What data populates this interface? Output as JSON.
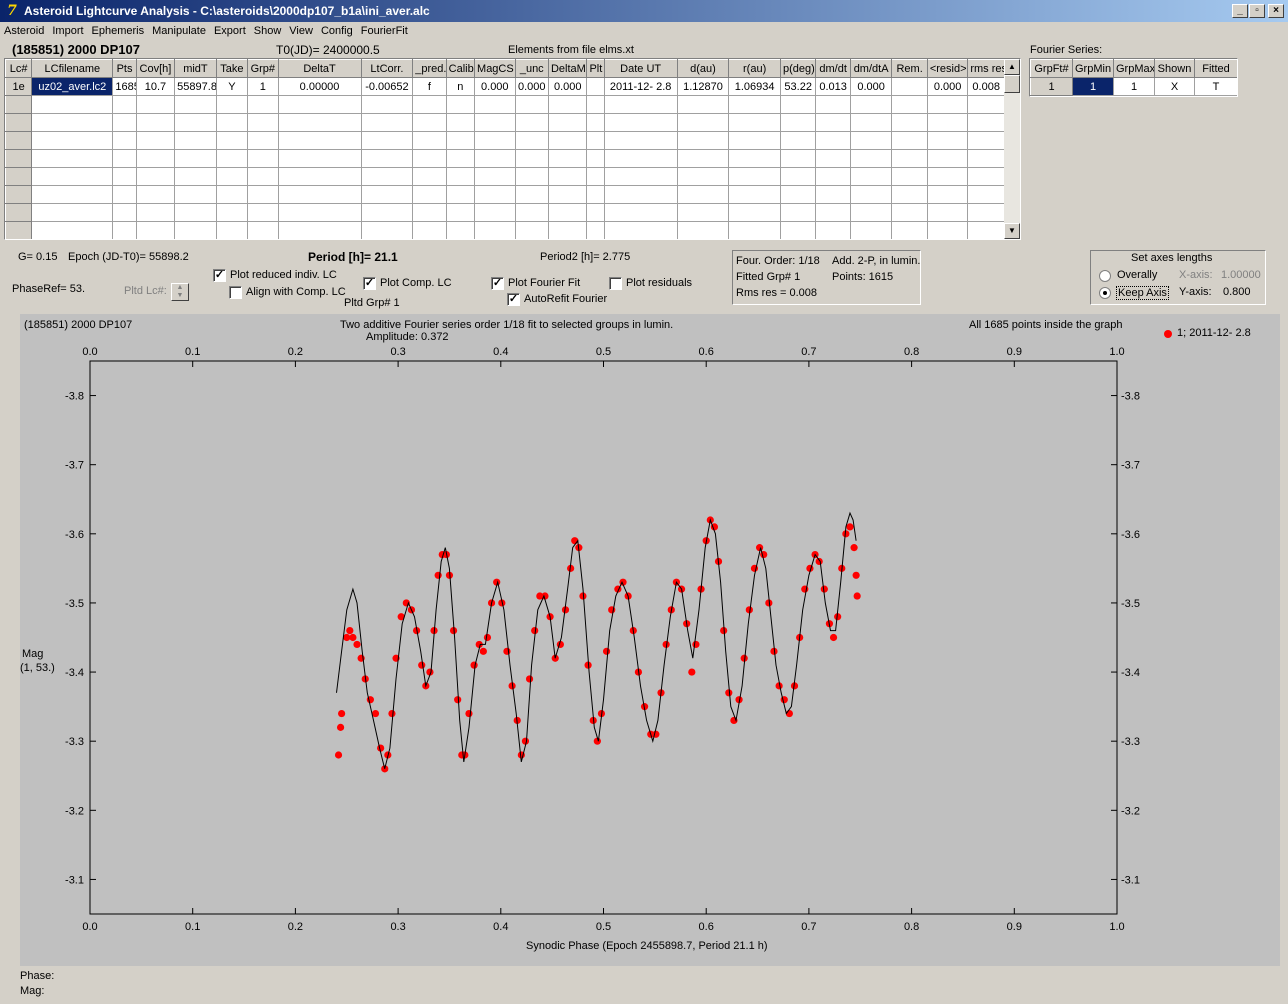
{
  "window": {
    "title": "Asteroid Lightcurve Analysis - C:\\asteroids\\2000dp107_b1a\\ini_aver.alc",
    "buttons": [
      "_",
      "̲",
      "X"
    ]
  },
  "menu": [
    "Asteroid",
    "Import",
    "Ephemeris",
    "Manipulate",
    "Export",
    "Show",
    "View",
    "Config",
    "FourierFit"
  ],
  "header": {
    "asteroid": "(185851) 2000 DP107",
    "t0": "T0(JD)= 2400000.5",
    "elements": "Elements from file elms.xt",
    "fourier_series_label": "Fourier Series:"
  },
  "lc_table": {
    "columns": [
      "Lc#",
      "LCfilename",
      "Pts",
      "Cov[h]",
      "midT",
      "Take",
      "Grp#",
      "DeltaT",
      "LtCorr.",
      "_pred.",
      "Calib.",
      "MagCS",
      "_unc",
      "DeltaM",
      "Plt",
      "Date UT",
      "d(au)",
      "r(au)",
      "p(deg)",
      "dm/dt",
      "dm/dtA",
      "Rem.",
      "<resid>",
      "rms res"
    ],
    "rows": [
      [
        "1e",
        "uz02_aver.lc2",
        "1685",
        "10.7",
        "55897.8",
        "Y",
        "1",
        "0.00000",
        "-0.00652",
        "f",
        "n",
        "0.000",
        "0.000",
        "0.000",
        "",
        "2011-12- 2.8",
        "1.12870",
        "1.06934",
        "53.22",
        "0.013",
        "0.000",
        "",
        "0.000",
        "0.008"
      ]
    ],
    "empty_rows": 8
  },
  "fourier_table": {
    "columns": [
      "GrpFt#",
      "GrpMin",
      "GrpMax",
      "Shown",
      "Fitted"
    ],
    "rows": [
      [
        "1",
        "1",
        "1",
        "X",
        "T"
      ]
    ]
  },
  "info": {
    "g": "G= 0.15",
    "epoch": "Epoch (JD-T0)= 55898.2",
    "period": "Period [h]= 21.1",
    "period2": "Period2 [h]= 2.775",
    "phaseref": "PhaseRef= 53.",
    "pltd_lc": "Pltd Lc#:",
    "pltd_grp": "Pltd Grp#  1"
  },
  "checkboxes": {
    "plot_reduced": {
      "label": "Plot reduced indiv. LC",
      "checked": true
    },
    "align_comp": {
      "label": "Align with Comp. LC",
      "checked": false
    },
    "plot_comp": {
      "label": "Plot Comp. LC",
      "checked": true
    },
    "plot_fourier": {
      "label": "Plot Fourier Fit",
      "checked": true
    },
    "autorefit": {
      "label": "AutoRefit Fourier",
      "checked": true
    },
    "plot_residuals": {
      "label": "Plot residuals",
      "checked": false
    }
  },
  "fit_info": {
    "order": "Four. Order:  1/18",
    "add": "Add. 2-P, in lumin.",
    "fitted": "Fitted Grp# 1",
    "points": "Points: 1615",
    "rms": "Rms res     = 0.008"
  },
  "axes_panel": {
    "title": "Set axes lengths",
    "overally": "Overally",
    "keep_axis": "Keep Axis",
    "x_axis_label": "X-axis:",
    "x_axis_value": "1.00000",
    "y_axis_label": "Y-axis:",
    "y_axis_value": "0.800",
    "selected": "keep_axis"
  },
  "plot_header": {
    "left": "(185851) 2000 DP107",
    "center_line1": "Two additive Fourier series order 1/18 fit to selected groups in lumin.",
    "center_line2": "Amplitude: 0.372",
    "right": "All 1685 points inside the graph",
    "legend": "1; 2011-12- 2.8",
    "ylabel_line1": "Mag",
    "ylabel_line2": "(1, 53.)"
  },
  "status": {
    "phase": "Phase:",
    "mag": "Mag:"
  },
  "chart_data": {
    "type": "scatter",
    "xlabel": "Synodic Phase (Epoch 2455898.7, Period 21.1 h)",
    "ylabel": "Mag (1, 53.)",
    "xlim": [
      0.0,
      1.0
    ],
    "ylim": [
      -3.05,
      -3.85
    ],
    "x_ticks": [
      "0.0",
      "0.1",
      "0.2",
      "0.3",
      "0.4",
      "0.5",
      "0.6",
      "0.7",
      "0.8",
      "0.9",
      "1.0"
    ],
    "y_ticks": [
      "-3.8",
      "-3.7",
      "-3.6",
      "-3.5",
      "-3.4",
      "-3.3",
      "-3.2",
      "-3.1"
    ],
    "series": [
      {
        "name": "1; 2011-12- 2.8",
        "color": "#ff0000",
        "points": [
          [
            0.242,
            -3.28
          ],
          [
            0.244,
            -3.32
          ],
          [
            0.245,
            -3.34
          ],
          [
            0.25,
            -3.45
          ],
          [
            0.253,
            -3.46
          ],
          [
            0.256,
            -3.45
          ],
          [
            0.26,
            -3.44
          ],
          [
            0.264,
            -3.42
          ],
          [
            0.268,
            -3.39
          ],
          [
            0.273,
            -3.36
          ],
          [
            0.278,
            -3.34
          ],
          [
            0.283,
            -3.29
          ],
          [
            0.287,
            -3.26
          ],
          [
            0.29,
            -3.28
          ],
          [
            0.294,
            -3.34
          ],
          [
            0.298,
            -3.42
          ],
          [
            0.303,
            -3.48
          ],
          [
            0.308,
            -3.5
          ],
          [
            0.313,
            -3.49
          ],
          [
            0.318,
            -3.46
          ],
          [
            0.323,
            -3.41
          ],
          [
            0.327,
            -3.38
          ],
          [
            0.331,
            -3.4
          ],
          [
            0.335,
            -3.46
          ],
          [
            0.339,
            -3.54
          ],
          [
            0.343,
            -3.57
          ],
          [
            0.347,
            -3.57
          ],
          [
            0.35,
            -3.54
          ],
          [
            0.354,
            -3.46
          ],
          [
            0.358,
            -3.36
          ],
          [
            0.362,
            -3.28
          ],
          [
            0.365,
            -3.28
          ],
          [
            0.369,
            -3.34
          ],
          [
            0.374,
            -3.41
          ],
          [
            0.379,
            -3.44
          ],
          [
            0.383,
            -3.43
          ],
          [
            0.387,
            -3.45
          ],
          [
            0.391,
            -3.5
          ],
          [
            0.396,
            -3.53
          ],
          [
            0.401,
            -3.5
          ],
          [
            0.406,
            -3.43
          ],
          [
            0.411,
            -3.38
          ],
          [
            0.416,
            -3.33
          ],
          [
            0.42,
            -3.28
          ],
          [
            0.424,
            -3.3
          ],
          [
            0.428,
            -3.39
          ],
          [
            0.433,
            -3.46
          ],
          [
            0.438,
            -3.51
          ],
          [
            0.443,
            -3.51
          ],
          [
            0.448,
            -3.48
          ],
          [
            0.453,
            -3.42
          ],
          [
            0.458,
            -3.44
          ],
          [
            0.463,
            -3.49
          ],
          [
            0.468,
            -3.55
          ],
          [
            0.472,
            -3.59
          ],
          [
            0.476,
            -3.58
          ],
          [
            0.48,
            -3.51
          ],
          [
            0.485,
            -3.41
          ],
          [
            0.49,
            -3.33
          ],
          [
            0.494,
            -3.3
          ],
          [
            0.498,
            -3.34
          ],
          [
            0.503,
            -3.43
          ],
          [
            0.508,
            -3.49
          ],
          [
            0.514,
            -3.52
          ],
          [
            0.519,
            -3.53
          ],
          [
            0.524,
            -3.51
          ],
          [
            0.529,
            -3.46
          ],
          [
            0.534,
            -3.4
          ],
          [
            0.54,
            -3.35
          ],
          [
            0.546,
            -3.31
          ],
          [
            0.551,
            -3.31
          ],
          [
            0.556,
            -3.37
          ],
          [
            0.561,
            -3.44
          ],
          [
            0.566,
            -3.49
          ],
          [
            0.571,
            -3.53
          ],
          [
            0.576,
            -3.52
          ],
          [
            0.581,
            -3.47
          ],
          [
            0.586,
            -3.4
          ],
          [
            0.59,
            -3.44
          ],
          [
            0.595,
            -3.52
          ],
          [
            0.6,
            -3.59
          ],
          [
            0.604,
            -3.62
          ],
          [
            0.608,
            -3.61
          ],
          [
            0.612,
            -3.56
          ],
          [
            0.617,
            -3.46
          ],
          [
            0.622,
            -3.37
          ],
          [
            0.627,
            -3.33
          ],
          [
            0.632,
            -3.36
          ],
          [
            0.637,
            -3.42
          ],
          [
            0.642,
            -3.49
          ],
          [
            0.647,
            -3.55
          ],
          [
            0.652,
            -3.58
          ],
          [
            0.656,
            -3.57
          ],
          [
            0.661,
            -3.5
          ],
          [
            0.666,
            -3.43
          ],
          [
            0.671,
            -3.38
          ],
          [
            0.676,
            -3.36
          ],
          [
            0.681,
            -3.34
          ],
          [
            0.686,
            -3.38
          ],
          [
            0.691,
            -3.45
          ],
          [
            0.696,
            -3.52
          ],
          [
            0.701,
            -3.55
          ],
          [
            0.706,
            -3.57
          ],
          [
            0.71,
            -3.56
          ],
          [
            0.715,
            -3.52
          ],
          [
            0.72,
            -3.47
          ],
          [
            0.724,
            -3.45
          ],
          [
            0.728,
            -3.48
          ],
          [
            0.732,
            -3.55
          ],
          [
            0.736,
            -3.6
          ],
          [
            0.74,
            -3.61
          ],
          [
            0.744,
            -3.58
          ],
          [
            0.746,
            -3.54
          ],
          [
            0.747,
            -3.51
          ]
        ]
      }
    ],
    "fourier_curve": [
      [
        0.24,
        -3.37
      ],
      [
        0.245,
        -3.43
      ],
      [
        0.25,
        -3.49
      ],
      [
        0.256,
        -3.52
      ],
      [
        0.26,
        -3.5
      ],
      [
        0.265,
        -3.43
      ],
      [
        0.27,
        -3.37
      ],
      [
        0.276,
        -3.33
      ],
      [
        0.282,
        -3.29
      ],
      [
        0.287,
        -3.26
      ],
      [
        0.292,
        -3.29
      ],
      [
        0.298,
        -3.39
      ],
      [
        0.304,
        -3.47
      ],
      [
        0.31,
        -3.5
      ],
      [
        0.316,
        -3.48
      ],
      [
        0.322,
        -3.43
      ],
      [
        0.327,
        -3.38
      ],
      [
        0.332,
        -3.4
      ],
      [
        0.337,
        -3.49
      ],
      [
        0.342,
        -3.56
      ],
      [
        0.346,
        -3.58
      ],
      [
        0.35,
        -3.55
      ],
      [
        0.355,
        -3.45
      ],
      [
        0.36,
        -3.33
      ],
      [
        0.364,
        -3.27
      ],
      [
        0.369,
        -3.32
      ],
      [
        0.375,
        -3.41
      ],
      [
        0.38,
        -3.44
      ],
      [
        0.385,
        -3.44
      ],
      [
        0.391,
        -3.5
      ],
      [
        0.397,
        -3.53
      ],
      [
        0.403,
        -3.49
      ],
      [
        0.409,
        -3.41
      ],
      [
        0.415,
        -3.34
      ],
      [
        0.42,
        -3.27
      ],
      [
        0.425,
        -3.3
      ],
      [
        0.43,
        -3.41
      ],
      [
        0.436,
        -3.49
      ],
      [
        0.442,
        -3.51
      ],
      [
        0.448,
        -3.48
      ],
      [
        0.453,
        -3.42
      ],
      [
        0.459,
        -3.45
      ],
      [
        0.465,
        -3.52
      ],
      [
        0.47,
        -3.58
      ],
      [
        0.475,
        -3.59
      ],
      [
        0.48,
        -3.52
      ],
      [
        0.486,
        -3.4
      ],
      [
        0.491,
        -3.32
      ],
      [
        0.495,
        -3.3
      ],
      [
        0.5,
        -3.36
      ],
      [
        0.506,
        -3.46
      ],
      [
        0.512,
        -3.51
      ],
      [
        0.518,
        -3.53
      ],
      [
        0.524,
        -3.51
      ],
      [
        0.53,
        -3.45
      ],
      [
        0.536,
        -3.38
      ],
      [
        0.542,
        -3.33
      ],
      [
        0.548,
        -3.3
      ],
      [
        0.553,
        -3.33
      ],
      [
        0.559,
        -3.41
      ],
      [
        0.565,
        -3.48
      ],
      [
        0.571,
        -3.53
      ],
      [
        0.576,
        -3.52
      ],
      [
        0.582,
        -3.46
      ],
      [
        0.587,
        -3.42
      ],
      [
        0.593,
        -3.49
      ],
      [
        0.599,
        -3.58
      ],
      [
        0.604,
        -3.62
      ],
      [
        0.609,
        -3.6
      ],
      [
        0.614,
        -3.53
      ],
      [
        0.619,
        -3.43
      ],
      [
        0.624,
        -3.35
      ],
      [
        0.629,
        -3.33
      ],
      [
        0.635,
        -3.38
      ],
      [
        0.641,
        -3.47
      ],
      [
        0.647,
        -3.54
      ],
      [
        0.653,
        -3.58
      ],
      [
        0.658,
        -3.55
      ],
      [
        0.663,
        -3.48
      ],
      [
        0.668,
        -3.41
      ],
      [
        0.673,
        -3.37
      ],
      [
        0.678,
        -3.34
      ],
      [
        0.683,
        -3.35
      ],
      [
        0.688,
        -3.41
      ],
      [
        0.694,
        -3.49
      ],
      [
        0.7,
        -3.54
      ],
      [
        0.706,
        -3.57
      ],
      [
        0.711,
        -3.56
      ],
      [
        0.716,
        -3.5
      ],
      [
        0.721,
        -3.46
      ],
      [
        0.726,
        -3.46
      ],
      [
        0.731,
        -3.53
      ],
      [
        0.736,
        -3.61
      ],
      [
        0.74,
        -3.63
      ],
      [
        0.743,
        -3.62
      ],
      [
        0.746,
        -3.59
      ]
    ]
  }
}
